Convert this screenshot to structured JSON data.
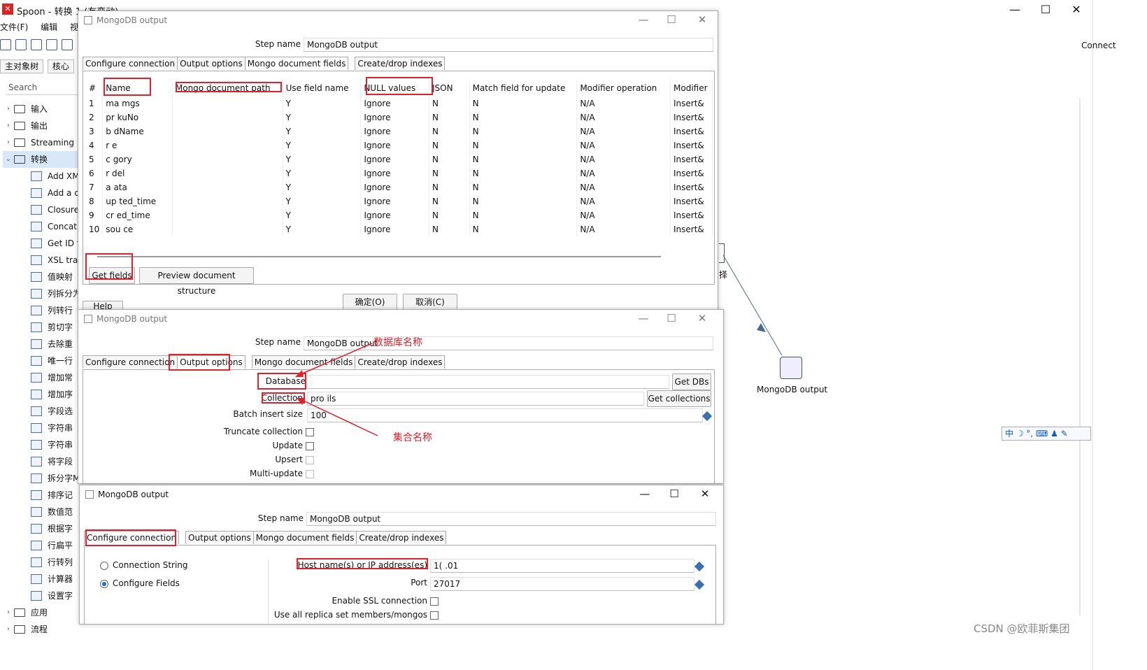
{
  "app": {
    "title": "Spoon - 转换 1 (有变动)",
    "menu": [
      "文件(F)",
      "编辑",
      "视图"
    ],
    "left_tabs": [
      "主对象树",
      "核心"
    ],
    "search_placeholder": "Search",
    "connect_label": "Connect",
    "tree": [
      {
        "label": "输入",
        "type": "folder",
        "expanded": false
      },
      {
        "label": "输出",
        "type": "folder",
        "expanded": false
      },
      {
        "label": "Streaming",
        "type": "folder",
        "expanded": false
      },
      {
        "label": "转换",
        "type": "folder",
        "expanded": true,
        "selected": true
      },
      {
        "label": "Add XM",
        "type": "leaf"
      },
      {
        "label": "Add a c",
        "type": "leaf"
      },
      {
        "label": "Closure",
        "type": "leaf"
      },
      {
        "label": "Concat",
        "type": "leaf"
      },
      {
        "label": "Get ID f",
        "type": "leaf"
      },
      {
        "label": "XSL trar",
        "type": "leaf"
      },
      {
        "label": "值映射",
        "type": "leaf"
      },
      {
        "label": "列拆分为",
        "type": "leaf"
      },
      {
        "label": "列转行",
        "type": "leaf"
      },
      {
        "label": "剪切字",
        "type": "leaf"
      },
      {
        "label": "去除重",
        "type": "leaf"
      },
      {
        "label": "唯一行",
        "type": "leaf"
      },
      {
        "label": "增加常",
        "type": "leaf"
      },
      {
        "label": "增加序",
        "type": "leaf"
      },
      {
        "label": "字段选",
        "type": "leaf"
      },
      {
        "label": "字符串",
        "type": "leaf"
      },
      {
        "label": "字符串",
        "type": "leaf"
      },
      {
        "label": "将字段",
        "type": "leaf"
      },
      {
        "label": "拆分字M",
        "type": "leaf"
      },
      {
        "label": "排序记",
        "type": "leaf"
      },
      {
        "label": "数值范",
        "type": "leaf"
      },
      {
        "label": "根据字",
        "type": "leaf"
      },
      {
        "label": "行扁平",
        "type": "leaf"
      },
      {
        "label": "行转列",
        "type": "leaf"
      },
      {
        "label": "计算器",
        "type": "leaf"
      },
      {
        "label": "设置字",
        "type": "leaf"
      },
      {
        "label": "应用",
        "type": "folder",
        "expanded": false
      },
      {
        "label": "流程",
        "type": "folder",
        "expanded": false
      }
    ],
    "canvas_node_label": "MongoDB output",
    "canvas_partial_label": "择",
    "ime_text": "中 ☽ °, ⌨ ♟ ✎",
    "watermark": "CSDN @欧菲斯集团"
  },
  "dialog1": {
    "title": "MongoDB output",
    "step_name_label": "Step name",
    "step_name_value": "MongoDB output",
    "tabs": [
      "Configure connection",
      "Output options",
      "Mongo document fields",
      "Create/drop indexes"
    ],
    "active_tab": 2,
    "columns": [
      "#",
      "Name",
      "Mongo document path",
      "Use field name",
      "NULL values",
      "JSON",
      "Match field for update",
      "Modifier operation",
      "Modifier"
    ],
    "rows": [
      {
        "n": "1",
        "name": "ma  mgs",
        "path": "",
        "use": "Y",
        "nulls": "Ignore",
        "json": "N",
        "match": "N",
        "op": "N/A",
        "mod": "Insert&"
      },
      {
        "n": "2",
        "name": "pr  kuNo",
        "path": "",
        "use": "Y",
        "nulls": "Ignore",
        "json": "N",
        "match": "N",
        "op": "N/A",
        "mod": "Insert&"
      },
      {
        "n": "3",
        "name": "b  dName",
        "path": "",
        "use": "Y",
        "nulls": "Ignore",
        "json": "N",
        "match": "N",
        "op": "N/A",
        "mod": "Insert&"
      },
      {
        "n": "4",
        "name": "r  e",
        "path": "",
        "use": "Y",
        "nulls": "Ignore",
        "json": "N",
        "match": "N",
        "op": "N/A",
        "mod": "Insert&"
      },
      {
        "n": "5",
        "name": "c  gory",
        "path": "",
        "use": "Y",
        "nulls": "Ignore",
        "json": "N",
        "match": "N",
        "op": "N/A",
        "mod": "Insert&"
      },
      {
        "n": "6",
        "name": "r  del",
        "path": "",
        "use": "Y",
        "nulls": "Ignore",
        "json": "N",
        "match": "N",
        "op": "N/A",
        "mod": "Insert&"
      },
      {
        "n": "7",
        "name": "a  ata",
        "path": "",
        "use": "Y",
        "nulls": "Ignore",
        "json": "N",
        "match": "N",
        "op": "N/A",
        "mod": "Insert&"
      },
      {
        "n": "8",
        "name": "up  ted_time",
        "path": "",
        "use": "Y",
        "nulls": "Ignore",
        "json": "N",
        "match": "N",
        "op": "N/A",
        "mod": "Insert&"
      },
      {
        "n": "9",
        "name": "cr  ed_time",
        "path": "",
        "use": "Y",
        "nulls": "Ignore",
        "json": "N",
        "match": "N",
        "op": "N/A",
        "mod": "Insert&"
      },
      {
        "n": "10",
        "name": "sou  ce",
        "path": "",
        "use": "Y",
        "nulls": "Ignore",
        "json": "N",
        "match": "N",
        "op": "N/A",
        "mod": "Insert&"
      }
    ],
    "get_fields_label": "Get fields",
    "preview_label": "Preview document structure",
    "ok_label": "确定(O)",
    "cancel_label": "取消(C)",
    "help_label": "Help"
  },
  "dialog2": {
    "title": "MongoDB output",
    "step_name_label": "Step name",
    "step_name_value": "MongoDB output",
    "annotation_db": "数据库名称",
    "annotation_collection": "集合名称",
    "tabs": [
      "Configure connection",
      "Output options",
      "Mongo document fields",
      "Create/drop indexes"
    ],
    "active_tab": 1,
    "database_label": "Database",
    "database_value": "",
    "get_dbs_label": "Get DBs",
    "collection_label": "Collection",
    "collection_value": "pro                    ils",
    "get_collections_label": "Get collections",
    "batch_label": "Batch insert size",
    "batch_value": "100",
    "truncate_label": "Truncate collection",
    "update_label": "Update",
    "upsert_label": "Upsert",
    "multi_update_label": "Multi-update"
  },
  "dialog3": {
    "title": "MongoDB output",
    "step_name_label": "Step name",
    "step_name_value": "MongoDB output",
    "tabs": [
      "Configure connection",
      "Output options",
      "Mongo document fields",
      "Create/drop indexes"
    ],
    "active_tab": 0,
    "conn_string_label": "Connection String",
    "configure_fields_label": "Configure Fields",
    "selected_mode": "Configure Fields",
    "host_label": "Host name(s) or IP address(es)",
    "host_value": "1(          .01",
    "port_label": "Port",
    "port_value": "27017",
    "ssl_label": "Enable SSL connection",
    "replica_label": "Use all replica set members/mongos"
  }
}
